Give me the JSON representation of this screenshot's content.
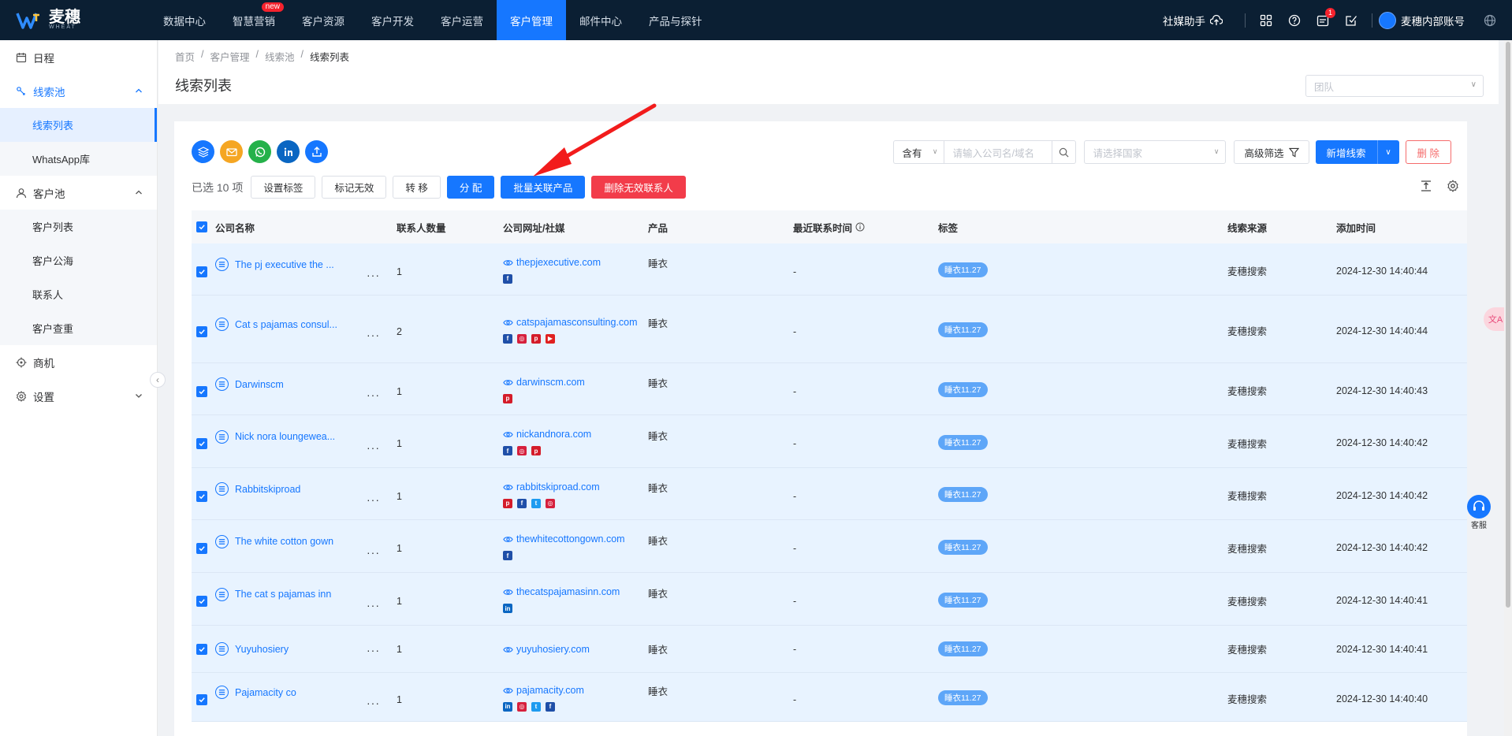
{
  "app": {
    "logo_text": "麦穗",
    "logo_sub": "WHEAT"
  },
  "nav": [
    {
      "label": "数据中心",
      "badge": ""
    },
    {
      "label": "智慧营销",
      "badge": "new"
    },
    {
      "label": "客户资源",
      "badge": ""
    },
    {
      "label": "客户开发",
      "badge": ""
    },
    {
      "label": "客户运营",
      "badge": ""
    },
    {
      "label": "客户管理",
      "badge": "",
      "active": true
    },
    {
      "label": "邮件中心",
      "badge": ""
    },
    {
      "label": "产品与探针",
      "badge": ""
    }
  ],
  "topright": {
    "social_helper": "社媒助手",
    "calendar_badge": "1",
    "user_name": "麦穗内部账号"
  },
  "sidebar": {
    "schedule": "日程",
    "lead_pool": "线索池",
    "lead_list": "线索列表",
    "whatsapp": "WhatsApp库",
    "customer_pool": "客户池",
    "customer_list": "客户列表",
    "customer_sea": "客户公海",
    "contacts": "联系人",
    "customer_dedupe": "客户查重",
    "opportunity": "商机",
    "settings": "设置"
  },
  "breadcrumb": [
    "首页",
    "客户管理",
    "线索池",
    "线索列表"
  ],
  "page_title": "线索列表",
  "team_placeholder": "团队",
  "filters": {
    "contains": "含有",
    "search_placeholder": "请输入公司名/域名",
    "country_placeholder": "请选择国家",
    "advanced": "高级筛选",
    "new_lead": "新增线索",
    "delete": "删 除"
  },
  "actions": {
    "selected": "已选 10 项",
    "set_tag": "设置标签",
    "mark_invalid": "标记无效",
    "transfer": "转 移",
    "assign": "分 配",
    "link_products": "批量关联产品",
    "delete_invalid_contacts": "删除无效联系人"
  },
  "columns": {
    "company": "公司名称",
    "contacts": "联系人数量",
    "site": "公司网址/社媒",
    "product": "产品",
    "last_contact": "最近联系时间",
    "tags": "标签",
    "source": "线索来源",
    "added": "添加时间"
  },
  "rows": [
    {
      "name": "The pj executive the ...",
      "count": "1",
      "site": "thepjexecutive.com",
      "socials": [
        "f"
      ],
      "product": "睡衣",
      "last": "-",
      "tag": "睡衣11.27",
      "source": "麦穗搜索",
      "time": "2024-12-30 14:40:44"
    },
    {
      "name": "Cat s pajamas consul...",
      "count": "2",
      "site": "catspajamasconsulting.com",
      "socials": [
        "f",
        "ig",
        "p",
        "yt"
      ],
      "product": "睡衣",
      "last": "-",
      "tag": "睡衣11.27",
      "source": "麦穗搜索",
      "time": "2024-12-30 14:40:44"
    },
    {
      "name": "Darwinscm",
      "count": "1",
      "site": "darwinscm.com",
      "socials": [
        "p"
      ],
      "product": "睡衣",
      "last": "-",
      "tag": "睡衣11.27",
      "source": "麦穗搜索",
      "time": "2024-12-30 14:40:43"
    },
    {
      "name": "Nick nora loungewea...",
      "count": "1",
      "site": "nickandnora.com",
      "socials": [
        "f",
        "ig",
        "p"
      ],
      "product": "睡衣",
      "last": "-",
      "tag": "睡衣11.27",
      "source": "麦穗搜索",
      "time": "2024-12-30 14:40:42"
    },
    {
      "name": "Rabbitskiproad",
      "count": "1",
      "site": "rabbitskiproad.com",
      "socials": [
        "p",
        "f",
        "tw",
        "ig"
      ],
      "product": "睡衣",
      "last": "-",
      "tag": "睡衣11.27",
      "source": "麦穗搜索",
      "time": "2024-12-30 14:40:42"
    },
    {
      "name": "The white cotton gown",
      "count": "1",
      "site": "thewhitecottongown.com",
      "socials": [
        "f"
      ],
      "product": "睡衣",
      "last": "-",
      "tag": "睡衣11.27",
      "source": "麦穗搜索",
      "time": "2024-12-30 14:40:42"
    },
    {
      "name": "The cat s pajamas inn",
      "count": "1",
      "site": "thecatspajamasinn.com",
      "socials": [
        "in"
      ],
      "product": "睡衣",
      "last": "-",
      "tag": "睡衣11.27",
      "source": "麦穗搜索",
      "time": "2024-12-30 14:40:41"
    },
    {
      "name": "Yuyuhosiery",
      "count": "1",
      "site": "yuyuhosiery.com",
      "socials": [],
      "product": "睡衣",
      "last": "-",
      "tag": "睡衣11.27",
      "source": "麦穗搜索",
      "time": "2024-12-30 14:40:41"
    },
    {
      "name": "Pajamacity co",
      "count": "1",
      "site": "pajamacity.com",
      "socials": [
        "in",
        "ig",
        "tw",
        "f"
      ],
      "product": "睡衣",
      "last": "-",
      "tag": "睡衣11.27",
      "source": "麦穗搜索",
      "time": "2024-12-30 14:40:40"
    }
  ],
  "float": {
    "service": "客服"
  },
  "colors": {
    "topbar": "#0b1f33",
    "accent": "#1677ff",
    "danger": "#f23c4a",
    "row_selected": "#e8f3ff",
    "annotation_arrow": "#f21c1c"
  }
}
